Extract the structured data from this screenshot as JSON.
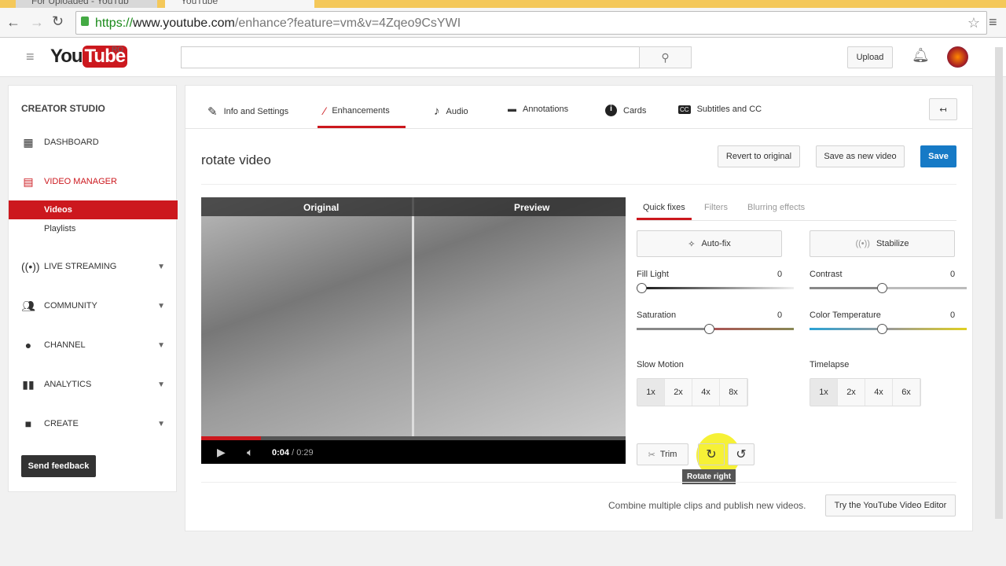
{
  "browser": {
    "tabs": [
      {
        "label": "For Uploaded - YouTub"
      },
      {
        "label": "YouTube"
      }
    ],
    "url_scheme": "https://",
    "url_host": "www.youtube.com",
    "url_path": "/enhance?feature=vm&v=4Zqeo9CsYWI"
  },
  "header": {
    "logo_you": "You",
    "logo_tube": "Tube",
    "region": "RO",
    "search_placeholder": "",
    "upload_label": "Upload"
  },
  "sidebar": {
    "title": "CREATOR STUDIO",
    "items": [
      {
        "label": "DASHBOARD",
        "icon": "dashboard-icon"
      },
      {
        "label": "VIDEO MANAGER",
        "icon": "video-manager-icon"
      },
      {
        "label": "Videos"
      },
      {
        "label": "Playlists"
      },
      {
        "label": "LIVE STREAMING",
        "icon": "live-icon"
      },
      {
        "label": "COMMUNITY",
        "icon": "community-icon"
      },
      {
        "label": "CHANNEL",
        "icon": "channel-icon"
      },
      {
        "label": "ANALYTICS",
        "icon": "analytics-icon"
      },
      {
        "label": "CREATE",
        "icon": "create-icon"
      }
    ],
    "feedback": "Send feedback"
  },
  "tabs": [
    {
      "label": "Info and Settings"
    },
    {
      "label": "Enhancements"
    },
    {
      "label": "Audio"
    },
    {
      "label": "Annotations"
    },
    {
      "label": "Cards"
    },
    {
      "label": "Subtitles and CC"
    }
  ],
  "page": {
    "title": "rotate video",
    "revert": "Revert to original",
    "save_new": "Save as new video",
    "save": "Save"
  },
  "player": {
    "original": "Original",
    "preview": "Preview",
    "time": "0:04",
    "duration": "0:29",
    "progress": 0.14
  },
  "fix_tabs": [
    {
      "label": "Quick fixes"
    },
    {
      "label": "Filters"
    },
    {
      "label": "Blurring effects"
    }
  ],
  "quick": {
    "autofix": "Auto-fix",
    "stabilize": "Stabilize",
    "sliders": [
      {
        "label": "Fill Light",
        "value": "0"
      },
      {
        "label": "Contrast",
        "value": "0"
      },
      {
        "label": "Saturation",
        "value": "0"
      },
      {
        "label": "Color Temperature",
        "value": "0"
      }
    ],
    "slow_motion": {
      "label": "Slow Motion",
      "options": [
        "1x",
        "2x",
        "4x",
        "8x"
      ],
      "selected": "1x"
    },
    "timelapse": {
      "label": "Timelapse",
      "options": [
        "1x",
        "2x",
        "4x",
        "6x"
      ],
      "selected": "1x"
    },
    "trim": "Trim",
    "tooltip": "Rotate right"
  },
  "footer": {
    "text": "Combine multiple clips and publish new videos.",
    "editor": "Try the YouTube Video Editor"
  },
  "colors": {
    "accent": "#cc181e",
    "save": "#167ac6"
  }
}
